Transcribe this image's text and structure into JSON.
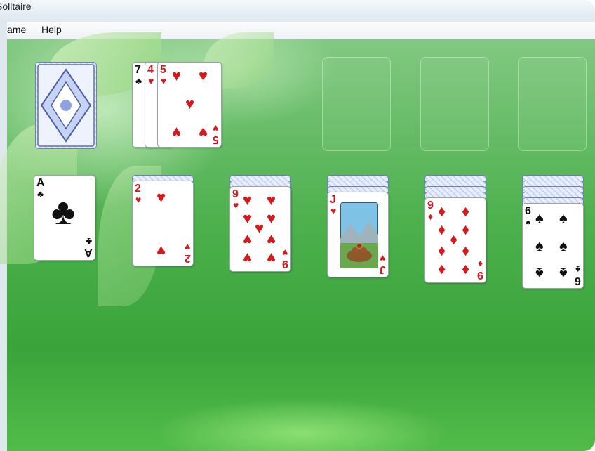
{
  "window": {
    "title": "Solitaire"
  },
  "menu": {
    "game": "ame",
    "help": "Help"
  },
  "colors": {
    "felt": "#3aa43a",
    "red_suit": "#d4191e",
    "black_suit": "#111111"
  },
  "stock": {
    "suit_icon": "card-back"
  },
  "waste": [
    {
      "rank": "7",
      "suit": "♣"
    },
    {
      "rank": "4",
      "suit": "♥"
    },
    {
      "rank": "5",
      "suit": "♥"
    }
  ],
  "foundations": [
    {},
    {},
    {}
  ],
  "tableau": [
    {
      "rank": "A",
      "suit": "♣",
      "hidden": 0
    },
    {
      "rank": "2",
      "suit": "♥",
      "hidden": 1
    },
    {
      "rank": "9",
      "suit": "♥",
      "hidden": 2
    },
    {
      "rank": "J",
      "suit": "♥",
      "hidden": 3
    },
    {
      "rank": "9",
      "suit": "♦",
      "hidden": 4
    },
    {
      "rank": "6",
      "suit": "♠",
      "hidden": 5
    }
  ]
}
